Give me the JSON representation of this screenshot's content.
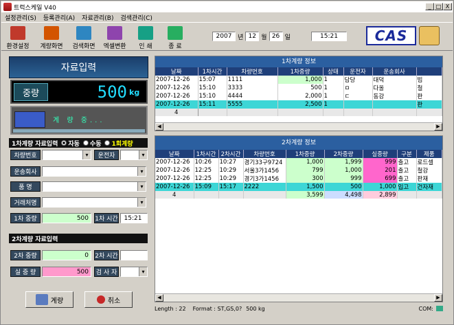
{
  "window": {
    "title": "트럭스케일 V40",
    "controls": [
      "_",
      "□",
      "X"
    ]
  },
  "menu": [
    "설정관리(S)",
    "등록관리(A)",
    "자료관리(B)",
    "검색관리(C)"
  ],
  "toolbar": {
    "buttons": [
      {
        "label": "환경설정",
        "icon": "settings-icon",
        "color": "#c0392b"
      },
      {
        "label": "계량화면",
        "icon": "truck-icon",
        "color": "#d35400"
      },
      {
        "label": "검색화면",
        "icon": "search-icon",
        "color": "#2e86c1"
      },
      {
        "label": "엑셀변환",
        "icon": "excel-icon",
        "color": "#8e44ad"
      },
      {
        "label": "인    쇄",
        "icon": "printer-icon",
        "color": "#16a085"
      },
      {
        "label": "종    료",
        "icon": "exit-icon",
        "color": "#27ae60"
      }
    ],
    "date": {
      "year": "2007",
      "y_unit": "년",
      "month": "12",
      "m_unit": "월",
      "day": "26",
      "d_unit": "일"
    },
    "time": "15:21",
    "brand": "CAS"
  },
  "left": {
    "header": "자료입력",
    "weight_label": "중량",
    "weight_value": "500",
    "weight_unit": "kg",
    "status": "계 량 중...",
    "first": {
      "title": "1차계량 자료입력",
      "modes": [
        "자동",
        "수동",
        "1회계량"
      ],
      "fields": {
        "vehicle": "차량번호",
        "driver": "운전자",
        "company": "운송회사",
        "item": "품    명",
        "client": "거래처명",
        "weight1_label": "1차 중량",
        "weight1": "500",
        "time1_label": "1차 시간",
        "time1": "15:21"
      }
    },
    "second": {
      "title": "2차계량 자료입력",
      "weight2_label": "2차 중량",
      "weight2": "0",
      "time2_label": "2차 시간",
      "time2": "",
      "net_label": "실 중 량",
      "net": "500",
      "inspector_label": "검 사 자",
      "inspector": ""
    },
    "btn_weigh": "계량",
    "btn_cancel": "취소"
  },
  "panel1": {
    "title": "1차계량 정보",
    "columns": [
      "날짜",
      "1차시간",
      "차량번호",
      "1차중량",
      "상태",
      "운전자",
      "운송회사",
      ""
    ],
    "rows": [
      [
        "2007-12-26",
        "15:07",
        "1111",
        "1,000",
        "1",
        "담당",
        "대덕",
        "빔"
      ],
      [
        "2007-12-26",
        "15:10",
        "3333",
        "500",
        "1",
        "ㅁ",
        "다올",
        "철"
      ],
      [
        "2007-12-26",
        "15:10",
        "4444",
        "2,000",
        "1",
        "ㄷ",
        "동강",
        "판"
      ],
      [
        "2007-12-26",
        "15:11",
        "5555",
        "2,500",
        "1",
        "",
        "",
        "판"
      ]
    ],
    "count": "4"
  },
  "panel2": {
    "title": "2차계량 정보",
    "columns": [
      "날짜",
      "1차시간",
      "2차시간",
      "차량번호",
      "1차중량",
      "2차중량",
      "실중량",
      "구분",
      "제품"
    ],
    "rows": [
      [
        "2007-12-26",
        "10:26",
        "10:27",
        "경기33구9724",
        "1,000",
        "1,999",
        "999",
        "출고",
        "로드셀"
      ],
      [
        "2007-12-26",
        "12:25",
        "10:29",
        "서울3가1456",
        "799",
        "1,000",
        "201",
        "출고",
        "철강"
      ],
      [
        "2007-12-26",
        "12:25",
        "10:29",
        "경기3가1456",
        "300",
        "999",
        "699",
        "출고",
        "판재"
      ],
      [
        "2007-12-26",
        "15:09",
        "15:17",
        "2222",
        "1,500",
        "500",
        "1,000",
        "입고",
        "건자재"
      ]
    ],
    "totals": [
      "4",
      "",
      "",
      "",
      "3,599",
      "4,498",
      "2,899",
      "",
      ""
    ]
  },
  "status": {
    "length": "Length : 22",
    "format": "Format : ST,GS,0?",
    "weight": "500 kg",
    "com": "COM:"
  }
}
